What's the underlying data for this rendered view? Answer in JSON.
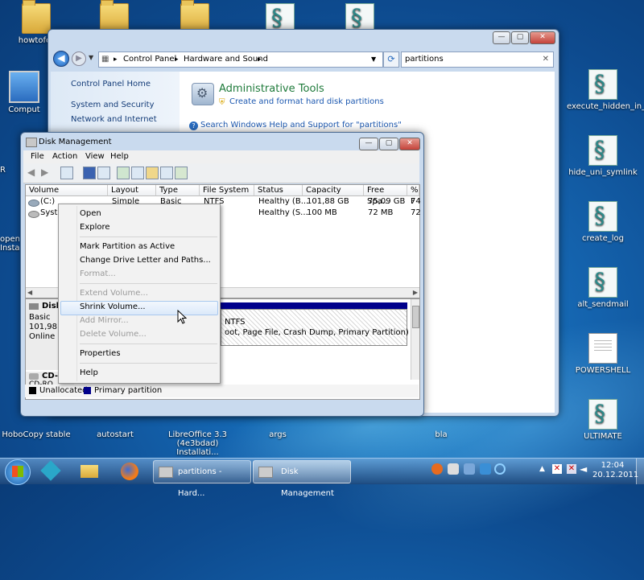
{
  "desktop": {
    "icons": [
      {
        "label": "howtofor",
        "kind": "folder"
      },
      {
        "label": "",
        "kind": "folder"
      },
      {
        "label": "",
        "kind": "folder"
      },
      {
        "label": "",
        "kind": "script"
      },
      {
        "label": "",
        "kind": "script"
      },
      {
        "label": "Comput",
        "kind": "pc"
      },
      {
        "label": "execute_hidden_in_reg",
        "kind": "script"
      },
      {
        "label": "hide_uni_symlink",
        "kind": "script"
      },
      {
        "label": "create_log",
        "kind": "script"
      },
      {
        "label": "alt_sendmail",
        "kind": "script"
      },
      {
        "label": "POWERSHELL",
        "kind": "doc"
      },
      {
        "label": "ULTIMATE",
        "kind": "script"
      },
      {
        "label": "HoboCopy stable",
        "kind": "folder"
      },
      {
        "label": "autostart",
        "kind": "script"
      },
      {
        "label": "LibreOffice 3.3 (4e3bdad) Installati...",
        "kind": "folder"
      },
      {
        "label": "args",
        "kind": "doc"
      },
      {
        "label": "bla",
        "kind": "doc"
      },
      {
        "label": "R",
        "kind": "partial"
      },
      {
        "label": "openO Insta",
        "kind": "partial"
      }
    ]
  },
  "control_panel": {
    "breadcrumb": [
      "Control Panel",
      "Hardware and Sound"
    ],
    "search_value": "partitions",
    "nav": [
      "Control Panel Home",
      "System and Security",
      "Network and Internet"
    ],
    "result_title": "Administrative Tools",
    "result_link": "Create and format hard disk partitions",
    "help_link": "Search Windows Help and Support for \"partitions\""
  },
  "disk_management": {
    "title": "Disk Management",
    "menu": [
      "File",
      "Action",
      "View",
      "Help"
    ],
    "columns": [
      "Volume",
      "Layout",
      "Type",
      "File System",
      "Status",
      "Capacity",
      "Free Spa...",
      "% F"
    ],
    "rows": [
      [
        "(C:)",
        "Simple",
        "Basic",
        "NTFS",
        "Healthy (B...",
        "101,88 GB",
        "75,09 GB",
        "74"
      ],
      [
        "Syste",
        "",
        "",
        "",
        "Healthy (S...",
        "100 MB",
        "72 MB",
        "72"
      ]
    ],
    "disk0": {
      "name": "Disk",
      "type": "Basic",
      "size": "101,98 G",
      "state": "Online"
    },
    "partition_fs": "NTFS",
    "partition_status": "oot, Page File, Crash Dump, Primary Partition)",
    "cdrom": {
      "name": "CD-",
      "type": "CD-RO"
    },
    "legend": [
      "Unallocated",
      "Primary partition"
    ]
  },
  "context_menu": {
    "items": [
      {
        "label": "Open",
        "enabled": true
      },
      {
        "label": "Explore",
        "enabled": true
      },
      {
        "label": "Mark Partition as Active",
        "enabled": true
      },
      {
        "label": "Change Drive Letter and Paths...",
        "enabled": true
      },
      {
        "label": "Format...",
        "enabled": false
      },
      {
        "label": "Extend Volume...",
        "enabled": false
      },
      {
        "label": "Shrink Volume...",
        "enabled": true
      },
      {
        "label": "Add Mirror...",
        "enabled": false
      },
      {
        "label": "Delete Volume...",
        "enabled": false
      },
      {
        "label": "Properties",
        "enabled": true
      },
      {
        "label": "Help",
        "enabled": true
      }
    ],
    "highlighted": "Shrink Volume..."
  },
  "taskbar": {
    "buttons": [
      "partitions - Hard...",
      "Disk Management"
    ],
    "time": "12:04",
    "date": "20.12.2011"
  },
  "colors": {
    "primary_partition": "#00008b",
    "unallocated": "#000000"
  }
}
